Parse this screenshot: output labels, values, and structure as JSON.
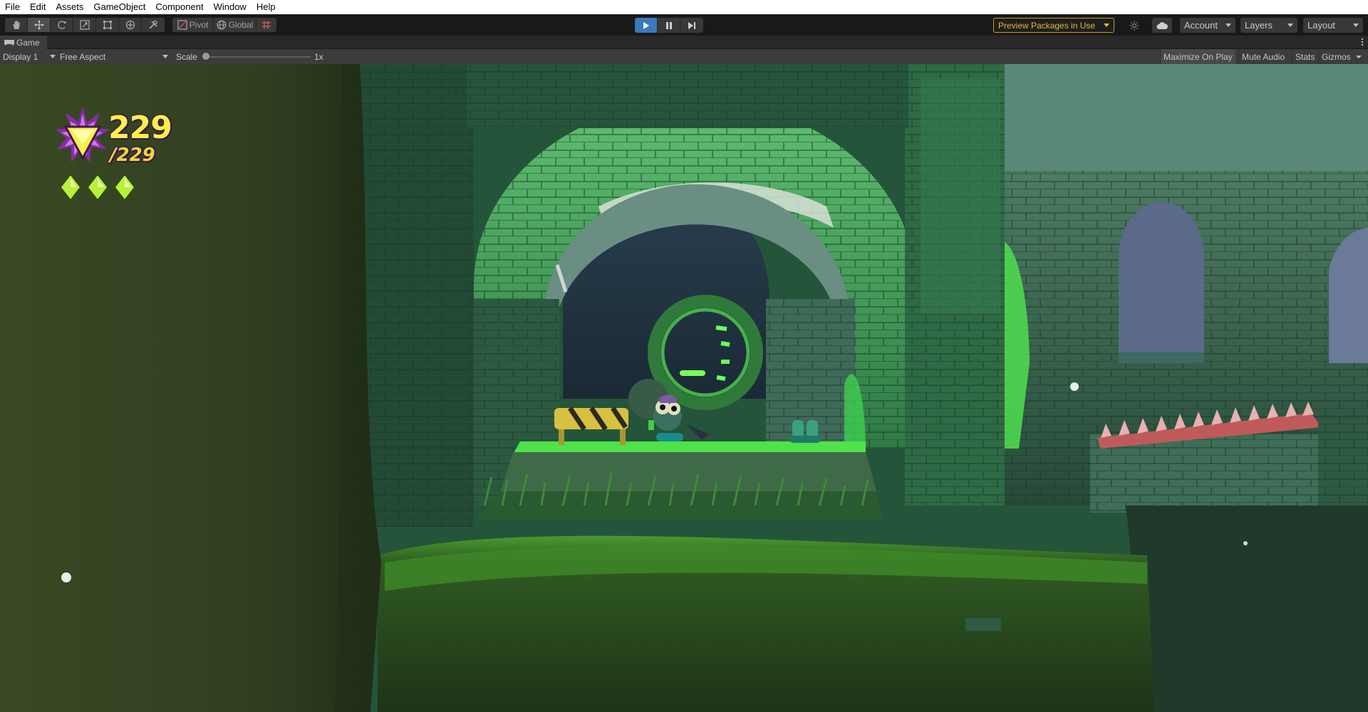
{
  "menu": [
    "File",
    "Edit",
    "Assets",
    "GameObject",
    "Component",
    "Window",
    "Help"
  ],
  "toolbar": {
    "tools": [
      "hand-tool",
      "move-tool",
      "rotate-tool",
      "scale-tool",
      "rect-tool",
      "transform-tool",
      "custom-tool"
    ],
    "pivot_label": "Pivot",
    "global_label": "Global",
    "preview_packages": "Preview Packages in Use",
    "account": "Account",
    "layers": "Layers",
    "layout": "Layout"
  },
  "tab": {
    "label": "Game"
  },
  "gamebar": {
    "display": "Display 1",
    "aspect": "Free Aspect",
    "scale_label": "Scale",
    "scale_value": "1x",
    "maximize": "Maximize On Play",
    "mute": "Mute Audio",
    "stats": "Stats",
    "gizmos": "Gizmos"
  },
  "hud": {
    "gem_count": "229",
    "gem_total": "/229",
    "lives": 3
  },
  "colors": {
    "play_active": "#3a79bb",
    "preview_border": "#c89f22",
    "hud_yellow": "#fbf04a",
    "scene_green": "#2f6b3a"
  }
}
